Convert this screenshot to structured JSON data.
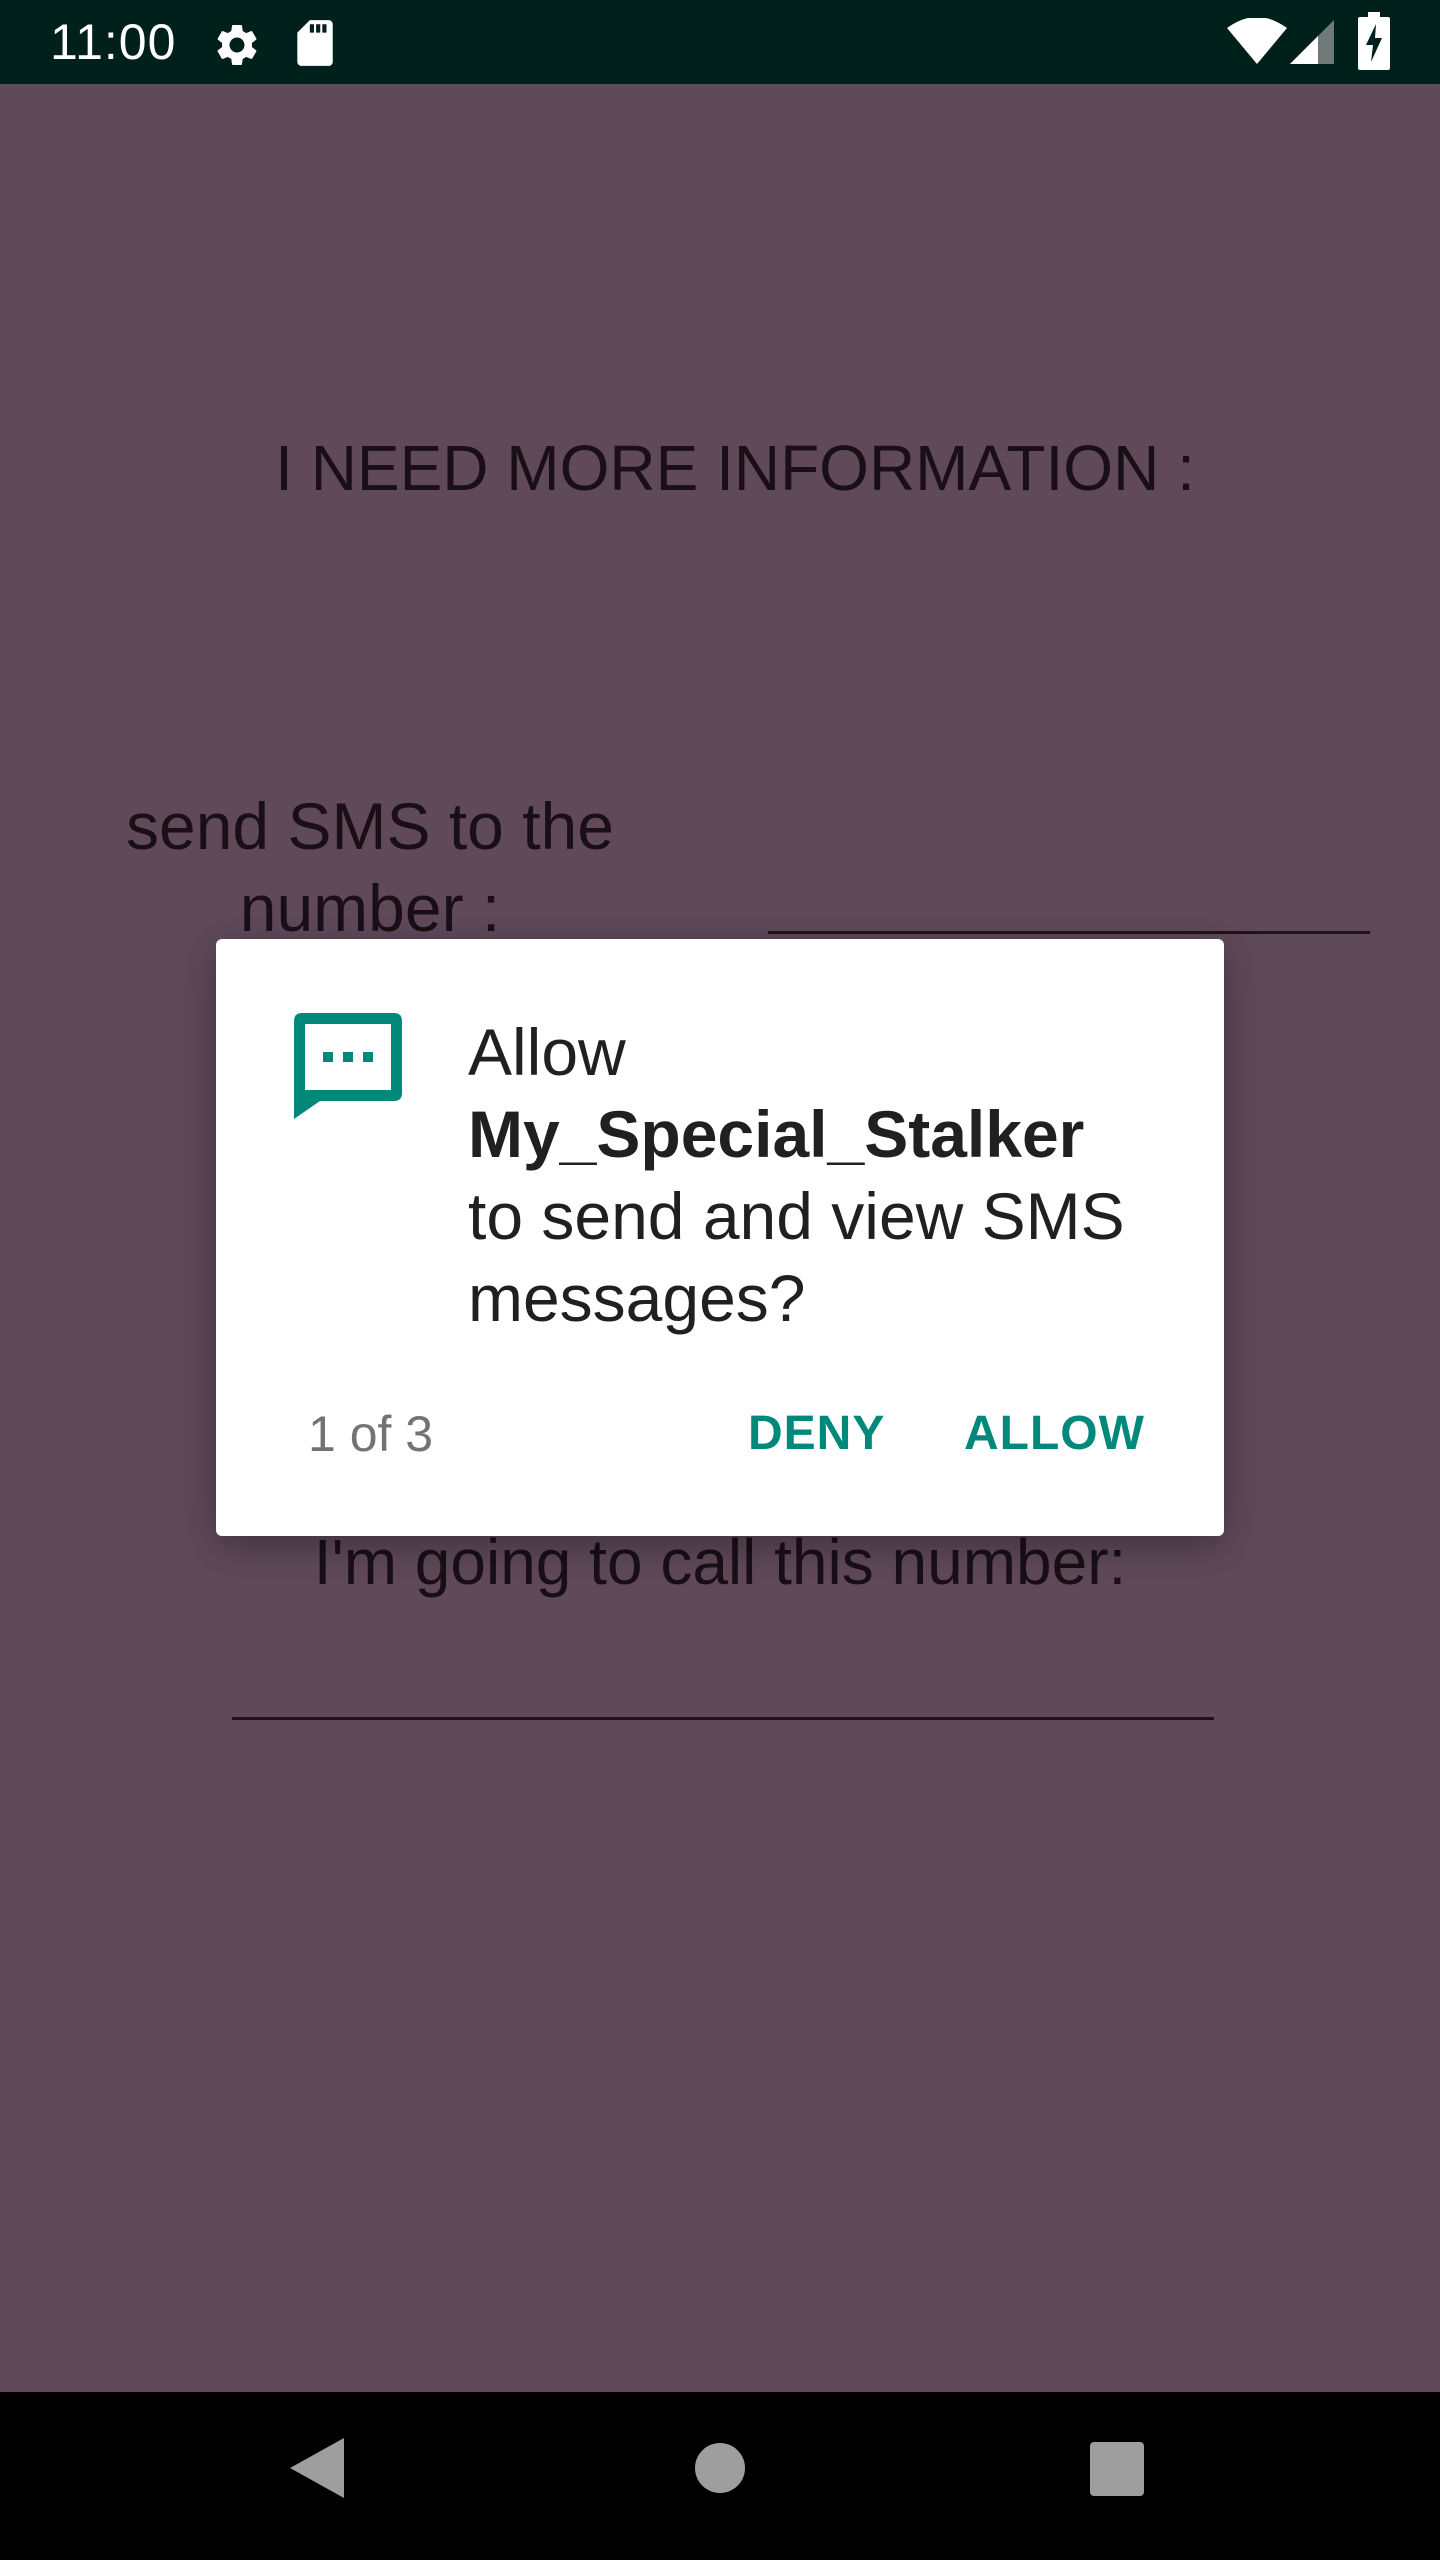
{
  "status_bar": {
    "time": "11:00",
    "icons": [
      "settings-icon",
      "sd-card-icon",
      "wifi-icon",
      "cell-signal-icon",
      "battery-charging-icon"
    ]
  },
  "screen": {
    "heading": "I NEED MORE INFORMATION :",
    "sms_label": "send SMS to the number :",
    "call_label": "I'm going to call this number:"
  },
  "dialog": {
    "icon": "sms-icon",
    "message_prefix": "Allow",
    "app_name": "My_Special_Stalker",
    "message_suffix_line1": "to send and view SMS",
    "message_suffix_line2": "messages?",
    "counter": "1 of 3",
    "deny_label": "DENY",
    "allow_label": "ALLOW",
    "accent_color": "#00897b"
  },
  "nav_bar": {
    "buttons": [
      "back-icon",
      "home-icon",
      "recents-icon"
    ]
  },
  "colors": {
    "status_bar_bg": "#00201c",
    "scrim_background": "#604a5a",
    "nav_bar_bg": "#000000"
  }
}
